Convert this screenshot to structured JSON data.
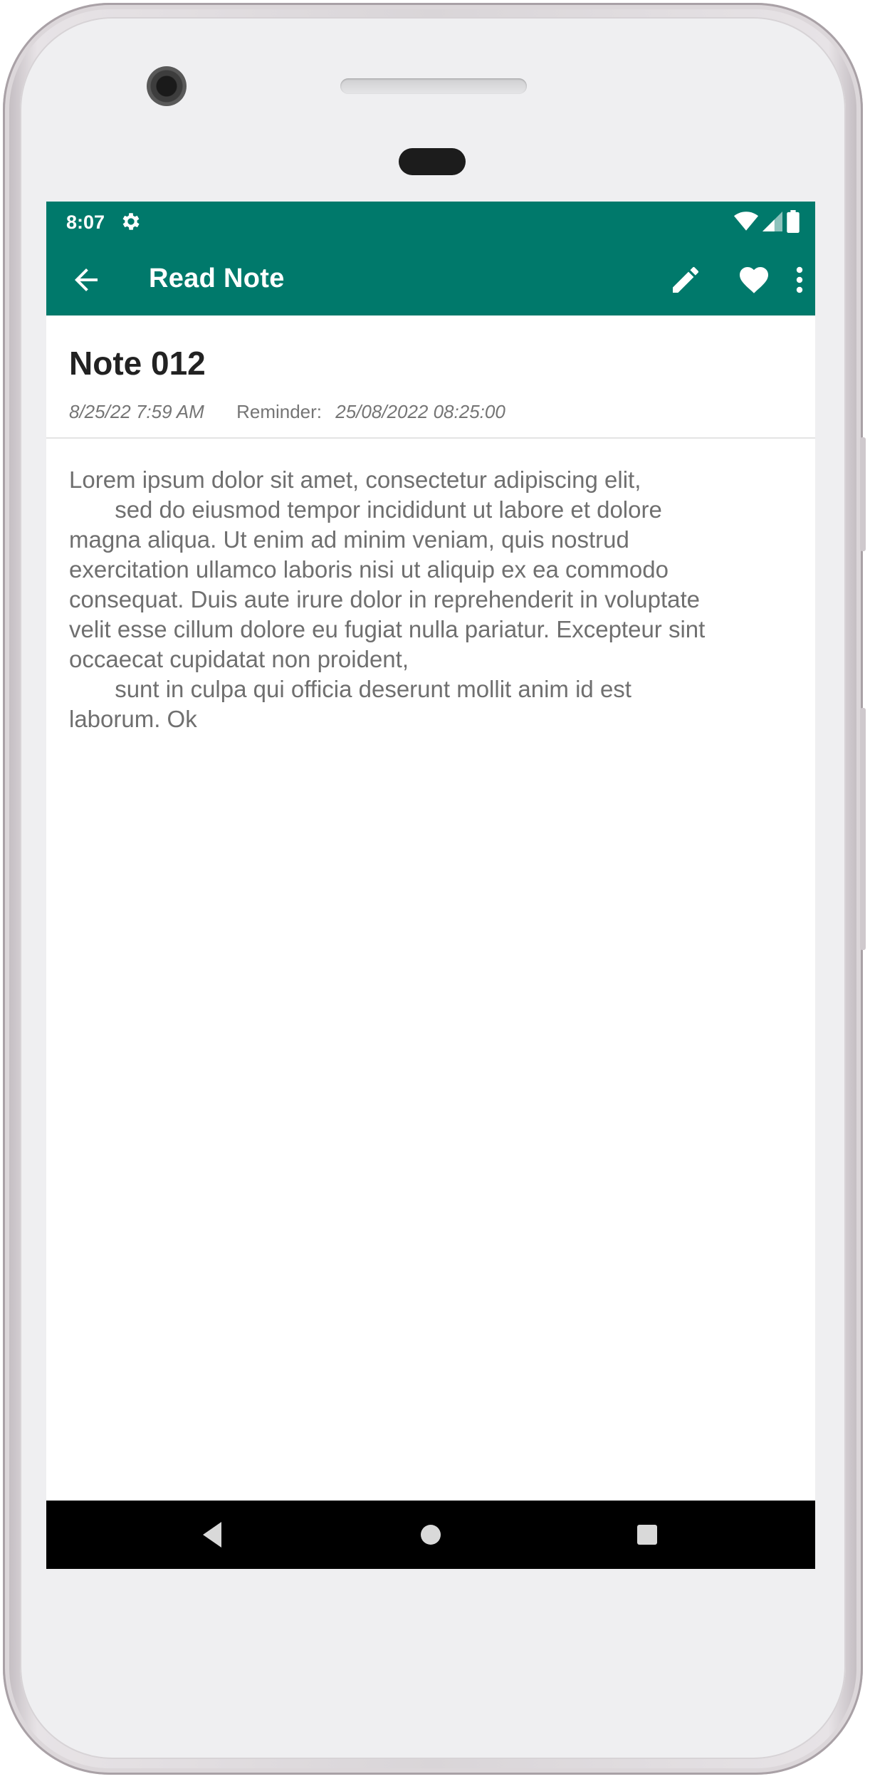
{
  "status_bar": {
    "time": "8:07",
    "icons": [
      "settings-icon",
      "wifi-icon",
      "signal-icon",
      "battery-icon"
    ]
  },
  "app_bar": {
    "title": "Read Note",
    "color": "#00796b",
    "actions": [
      "edit-icon",
      "favorite-heart-icon",
      "more-vert-icon"
    ]
  },
  "note": {
    "title": "Note 012",
    "created": "8/25/22 7:59 AM",
    "reminder_label": "Reminder:",
    "reminder_value": "25/08/2022 08:25:00",
    "body": "Lorem ipsum dolor sit amet, consectetur adipiscing elit,\n       sed do eiusmod tempor incididunt ut labore et dolore\nmagna aliqua. Ut enim ad minim veniam, quis nostrud\nexercitation ullamco laboris nisi ut aliquip ex ea commodo\nconsequat. Duis aute irure dolor in reprehenderit in voluptate\nvelit esse cillum dolore eu fugiat nulla pariatur. Excepteur sint\noccaecat cupidatat non proident,\n       sunt in culpa qui officia deserunt mollit anim id est\nlaborum. Ok"
  },
  "nav_bar": {
    "buttons": [
      "back-triangle-icon",
      "home-circle-icon",
      "recents-square-icon"
    ]
  }
}
